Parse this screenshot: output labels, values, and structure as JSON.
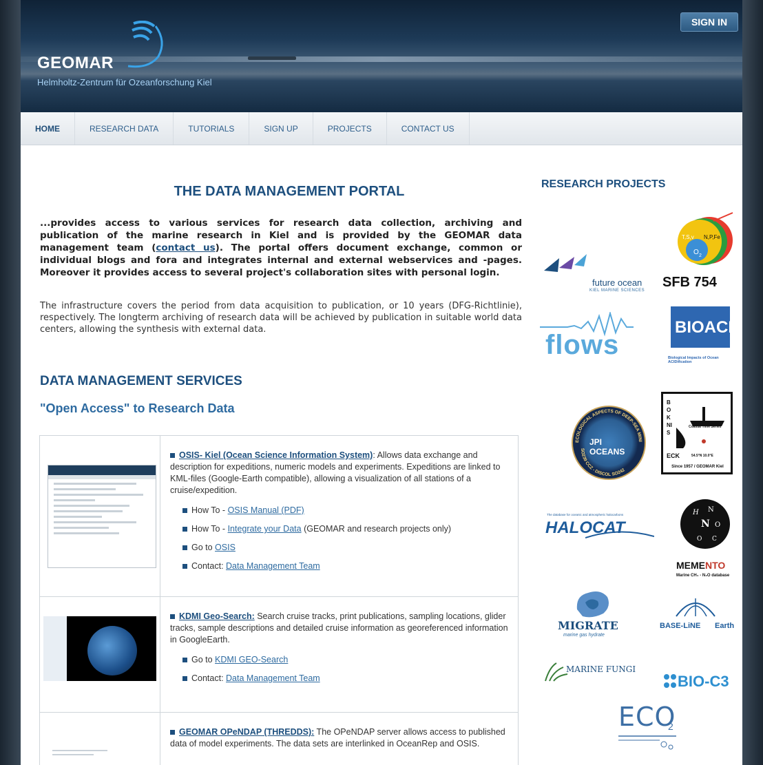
{
  "header": {
    "logo_word": "GEOMAR",
    "logo_subtitle": "Helmholtz-Zentrum für Ozeanforschung Kiel",
    "sign_in": "SIGN IN"
  },
  "nav": {
    "items": [
      "HOME",
      "RESEARCH DATA",
      "TUTORIALS",
      "SIGN UP",
      "PROJECTS",
      "CONTACT US"
    ],
    "active_index": 0
  },
  "main": {
    "title": "THE DATA MANAGEMENT PORTAL",
    "intro_bold_part1": "...provides access to various services for research data collection, archiving and publication of the marine research in Kiel and is provided by the GEOMAR data management team (",
    "intro_bold_link": "contact us",
    "intro_bold_part2": "). The portal offers document exchange, common or individual blogs and fora and integrates internal and external webservices and -pages. Moreover it provides access to several project's collaboration sites with personal login.",
    "intro_normal": "The infrastructure covers the period from data acquisition to publication, or 10 years (DFG-Richtlinie), respectively. The longterm archiving of research data will be achieved by publication in suitable world data centers, allowing the synthesis with external data.",
    "services_heading": "DATA MANAGEMENT SERVICES",
    "open_access_heading": "\"Open Access\" to Research Data",
    "services": [
      {
        "title": "OSIS- Kiel (Ocean Science Information System)",
        "description": ": Allows data exchange and description for expeditions, numeric models and experiments. Expeditions are linked to KML-files (Google-Earth compatible), allowing a visualization of all stations of a cruise/expedition.",
        "links": [
          {
            "prefix": "How To - ",
            "link": "OSIS Manual (PDF)",
            "suffix": ""
          },
          {
            "prefix": "How To - ",
            "link": "Integrate your Data",
            "suffix": " (GEOMAR and research projects only)"
          },
          {
            "prefix": "Go to ",
            "link": "OSIS",
            "suffix": ""
          },
          {
            "prefix": "Contact: ",
            "link": "Data Management Team",
            "suffix": ""
          }
        ]
      },
      {
        "title": "KDMI Geo-Search:",
        "description": " Search cruise tracks, print publications, sampling locations, glider tracks, sample descriptions and detailed cruise information as georeferenced information in GoogleEarth.",
        "links": [
          {
            "prefix": "Go to ",
            "link": "KDMI GEO-Search",
            "suffix": ""
          },
          {
            "prefix": "Contact: ",
            "link": "Data Management Team",
            "suffix": ""
          }
        ]
      },
      {
        "title": "GEOMAR OPeNDAP (THREDDS):",
        "description": " The OPeNDAP server allows access to published data of model experiments. The data sets are interlinked in OceanRep and OSIS.",
        "links": []
      }
    ]
  },
  "sidebar": {
    "title": "RESEARCH PROJECTS",
    "logos": {
      "future_ocean": "future ocean",
      "future_ocean_sub": "KIEL MARINE SCIENCES",
      "sfb": "SFB 754",
      "sfb_labels": [
        "T,S,v",
        "N,P,Fe",
        "O",
        "2"
      ],
      "flows": "flows",
      "bioacid": "BIOACID",
      "bioacid_sub": "Biological Impacts of Ocean ACIDification",
      "jpi": "JPI OCEANS",
      "jpi_ring_top": "ECOLOGICAL ASPECTS OF DEEP-SEA MINING",
      "jpi_ring_bottom": "SO239 CCZ - DISCOL SO242",
      "boknis_letters": "BOKNIS",
      "boknis_eck": "ECK",
      "boknis_coastal": "Coastal Time Series",
      "boknis_coord": "54.5°N 10.0°E",
      "boknis_since": "Since 1957 / GEOMAR Kiel",
      "halocat": "HALOCAT",
      "halocat_sub": "The database for oceanic and atmospheric halocarbons",
      "memento_pre": "MEME",
      "memento_red": "NTO",
      "memento_sub": "Marine CH₄ - N₂O database",
      "migrate": "MIGRATE",
      "migrate_sub": "marine gas hydrate",
      "baseline": "BASE-LiNE",
      "baseline_earth": "Earth",
      "fungi": "MARINE FUNGI",
      "bioc3": "BIO-C3",
      "eco2": "ECO",
      "eco2_sub": "2"
    },
    "colors": {
      "accent": "#1d4f7e",
      "link": "#2d6aa0"
    }
  }
}
